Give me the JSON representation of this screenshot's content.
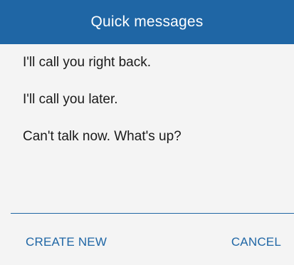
{
  "dialog": {
    "title": "Quick messages",
    "messages": [
      {
        "label": "I'll call you right back."
      },
      {
        "label": "I'll call you later."
      },
      {
        "label": "Can't talk now. What's up?"
      }
    ],
    "actions": {
      "create_new": "CREATE NEW",
      "cancel": "CANCEL"
    }
  },
  "colors": {
    "accent": "#1f66a5",
    "background": "#f4f4f4",
    "text": "#1a1a1a"
  }
}
